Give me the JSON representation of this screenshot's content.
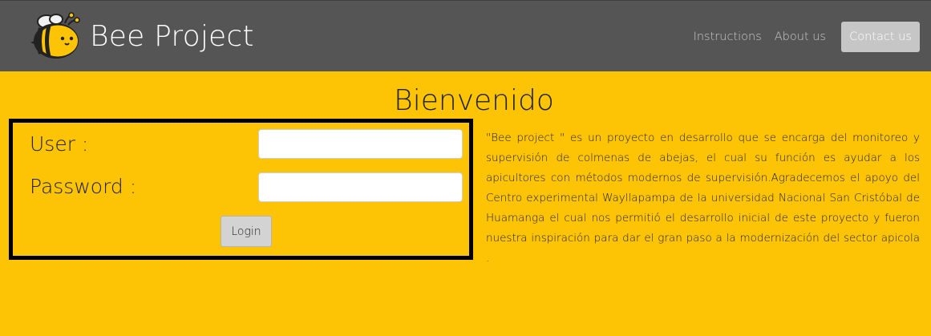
{
  "navbar": {
    "brand_text": "Bee Project",
    "logo_icon": "bee-icon",
    "links": [
      "Instructions",
      "About us"
    ],
    "contact_label": "Contact us",
    "background_color": "#555555"
  },
  "main": {
    "title": "Bienvenido",
    "background_color": "#fdc305"
  },
  "login": {
    "user_label": "User :",
    "password_label": "Password :",
    "user_value": "",
    "password_value": "",
    "button_label": "Login"
  },
  "description": "\"Bee project \" es un proyecto en desarrollo que se encarga del monitoreo y supervisión de colmenas de abejas, el cual su función es ayudar a los apicultores con métodos modernos de supervisión.Agradecemos el apoyo del Centro experimental Wayllapampa de la universidad Nacional San Cristóbal de Huamanga el cual nos permitió el desarrollo inicial de este proyecto y fueron nuestra inspiración para dar el gran paso a la modernización del sector apicola ."
}
